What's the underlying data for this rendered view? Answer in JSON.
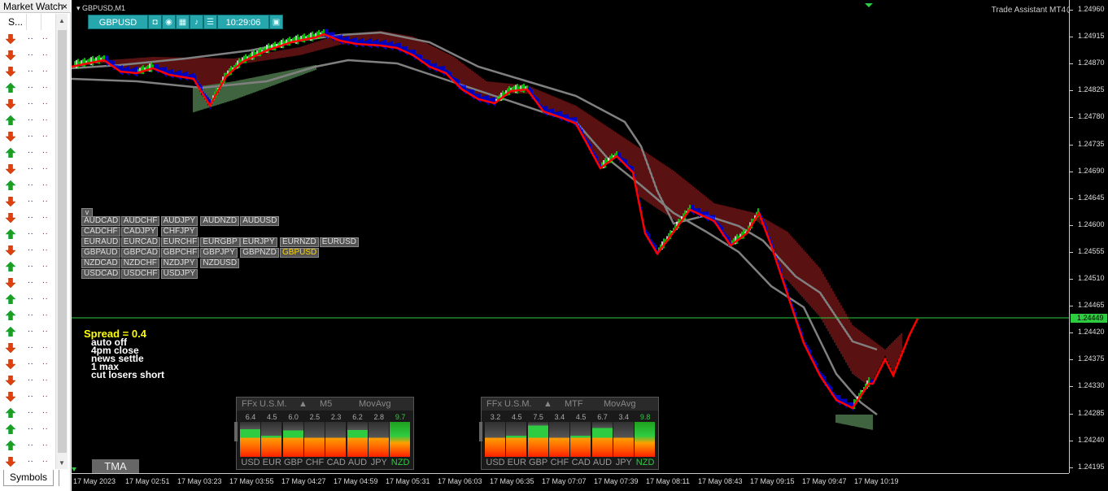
{
  "market_watch": {
    "title": "Market Watch",
    "close": "×",
    "col_symbol": "S...",
    "col_bid": ". .",
    "col_ask": ". .",
    "rows": [
      {
        "dir": "down",
        "bid": "..",
        "ask": ".."
      },
      {
        "dir": "down",
        "bid": "..",
        "ask": ".."
      },
      {
        "dir": "down",
        "bid": "..",
        "ask": ".."
      },
      {
        "dir": "up",
        "bid": "..",
        "ask": ".."
      },
      {
        "dir": "down",
        "bid": "..",
        "ask": ".."
      },
      {
        "dir": "up",
        "bid": "..",
        "ask": ".."
      },
      {
        "dir": "down",
        "bid": "..",
        "ask": ".."
      },
      {
        "dir": "up",
        "bid": "..",
        "ask": ".."
      },
      {
        "dir": "down",
        "bid": "..",
        "ask": ".."
      },
      {
        "dir": "up",
        "bid": "..",
        "ask": ".."
      },
      {
        "dir": "down",
        "bid": "..",
        "ask": ".."
      },
      {
        "dir": "down",
        "bid": "..",
        "ask": ".."
      },
      {
        "dir": "up",
        "bid": "..",
        "ask": ".."
      },
      {
        "dir": "down",
        "bid": "..",
        "ask": ".."
      },
      {
        "dir": "up",
        "bid": "..",
        "ask": ".."
      },
      {
        "dir": "down",
        "bid": "..",
        "ask": ".."
      },
      {
        "dir": "up",
        "bid": "..",
        "ask": ".."
      },
      {
        "dir": "up",
        "bid": "..",
        "ask": ".."
      },
      {
        "dir": "up",
        "bid": "..",
        "ask": ".."
      },
      {
        "dir": "down",
        "bid": "..",
        "ask": ".."
      },
      {
        "dir": "down",
        "bid": "..",
        "ask": ".."
      },
      {
        "dir": "down",
        "bid": "..",
        "ask": ".."
      },
      {
        "dir": "down",
        "bid": "..",
        "ask": ".."
      },
      {
        "dir": "up",
        "bid": "..",
        "ask": ".."
      },
      {
        "dir": "up",
        "bid": "..",
        "ask": ".."
      },
      {
        "dir": "up",
        "bid": "..",
        "ask": ".."
      },
      {
        "dir": "down",
        "bid": "..",
        "ask": ".."
      }
    ],
    "tab_label": "Symbols"
  },
  "chart": {
    "title": "GBPUSD,M1",
    "toolbar": {
      "symbol": "GBPUSD",
      "time": "10:29:06",
      "icons": [
        "camera-icon",
        "eye-icon",
        "calendar-icon",
        "bell-icon",
        "list-icon"
      ]
    },
    "assistant_label": "Trade Assistant MT4",
    "price_labels": [
      "1.24960",
      "1.24915",
      "1.24870",
      "1.24825",
      "1.24780",
      "1.24735",
      "1.24690",
      "1.24645",
      "1.24600",
      "1.24555",
      "1.24510",
      "1.24465",
      "1.24420",
      "1.24375",
      "1.24330",
      "1.24285",
      "1.24240",
      "1.24195"
    ],
    "current_price": "1.24449",
    "time_labels": [
      "17 May 2023",
      "17 May 02:51",
      "17 May 03:23",
      "17 May 03:55",
      "17 May 04:27",
      "17 May 04:59",
      "17 May 05:31",
      "17 May 06:03",
      "17 May 06:35",
      "17 May 07:07",
      "17 May 07:39",
      "17 May 08:11",
      "17 May 08:43",
      "17 May 09:15",
      "17 May 09:47",
      "17 May 10:19"
    ],
    "colors": {
      "bull": "#00ff00",
      "bear": "#0000ff",
      "band_upper": "#b22222",
      "band_lower": "#7fc97f",
      "ma": "#808080",
      "red_ma": "#ff0000",
      "current_line": "#2ecc40"
    }
  },
  "pairs": {
    "toggle": "v",
    "rows": [
      [
        "AUDCAD",
        "AUDCHF",
        "AUDJPY",
        "AUDNZD",
        "AUDUSD"
      ],
      [
        "CADCHF",
        "CADJPY",
        "CHFJPY"
      ],
      [
        "EURAUD",
        "EURCAD",
        "EURCHF",
        "EURGBP",
        "EURJPY",
        "EURNZD",
        "EURUSD"
      ],
      [
        "GBPAUD",
        "GBPCAD",
        "GBPCHF",
        "GBPJPY",
        "GBPNZD",
        "GBPUSD"
      ],
      [
        "NZDCAD",
        "NZDCHF",
        "NZDJPY",
        "NZDUSD"
      ],
      [
        "USDCAD",
        "USDCHF",
        "USDJPY"
      ]
    ],
    "active": "GBPUSD"
  },
  "notes": {
    "spread": "Spread = 0.4",
    "lines": [
      "auto off",
      "4pm close",
      "news settle",
      "1 max",
      "cut losers short"
    ]
  },
  "panels": [
    {
      "header": [
        "FFx U.S.M.",
        "▲",
        "M5",
        "MovAvg"
      ],
      "values": [
        "6.4",
        "4.5",
        "6.0",
        "2.5",
        "2.3",
        "6.2",
        "2.8",
        "9.7"
      ],
      "strengths": [
        0.64,
        0.45,
        0.6,
        0.25,
        0.23,
        0.62,
        0.28,
        0.97
      ],
      "currencies": [
        "USD",
        "EUR",
        "GBP",
        "CHF",
        "CAD",
        "AUD",
        "JPY",
        "NZD"
      ],
      "highlight": "NZD"
    },
    {
      "header": [
        "FFx U.S.M.",
        "▲",
        "MTF",
        "MovAvg"
      ],
      "values": [
        "3.2",
        "4.5",
        "7.5",
        "3.4",
        "4.5",
        "6.7",
        "3.4",
        "9.8"
      ],
      "strengths": [
        0.32,
        0.45,
        0.75,
        0.34,
        0.45,
        0.67,
        0.34,
        0.98
      ],
      "currencies": [
        "USD",
        "EUR",
        "GBP",
        "CHF",
        "CAD",
        "AUD",
        "JPY",
        "NZD"
      ],
      "highlight": "NZD"
    }
  ],
  "tma_label": "TMA"
}
